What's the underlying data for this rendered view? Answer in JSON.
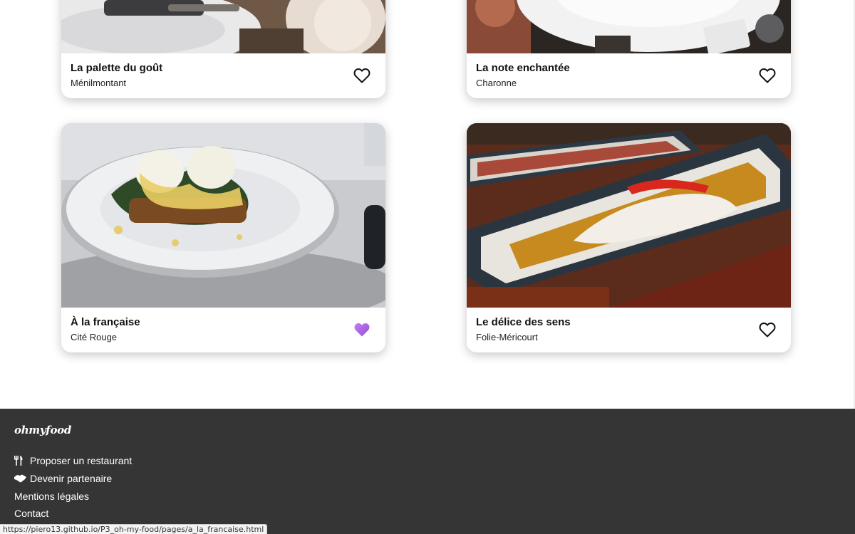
{
  "restaurants": [
    {
      "name": "La palette du goût",
      "area": "Ménilmontant",
      "liked": false
    },
    {
      "name": "La note enchantée",
      "area": "Charonne",
      "liked": false
    },
    {
      "name": "À la française",
      "area": "Cité Rouge",
      "liked": true
    },
    {
      "name": "Le délice des sens",
      "area": "Folie-Méricourt",
      "liked": false
    }
  ],
  "footer": {
    "brand": "ohmyfood",
    "links": [
      {
        "label": "Proposer un restaurant",
        "icon": "utensils-icon"
      },
      {
        "label": "Devenir partenaire",
        "icon": "handshake-icon"
      },
      {
        "label": "Mentions légales",
        "icon": ""
      },
      {
        "label": "Contact",
        "icon": ""
      }
    ]
  },
  "status_url": "https://piero13.github.io/P3_oh-my-food/pages/a_la_francaise.html",
  "colors": {
    "footer_bg": "#353535",
    "heart_active": "#a45ee5",
    "heart_outline": "#111111"
  }
}
